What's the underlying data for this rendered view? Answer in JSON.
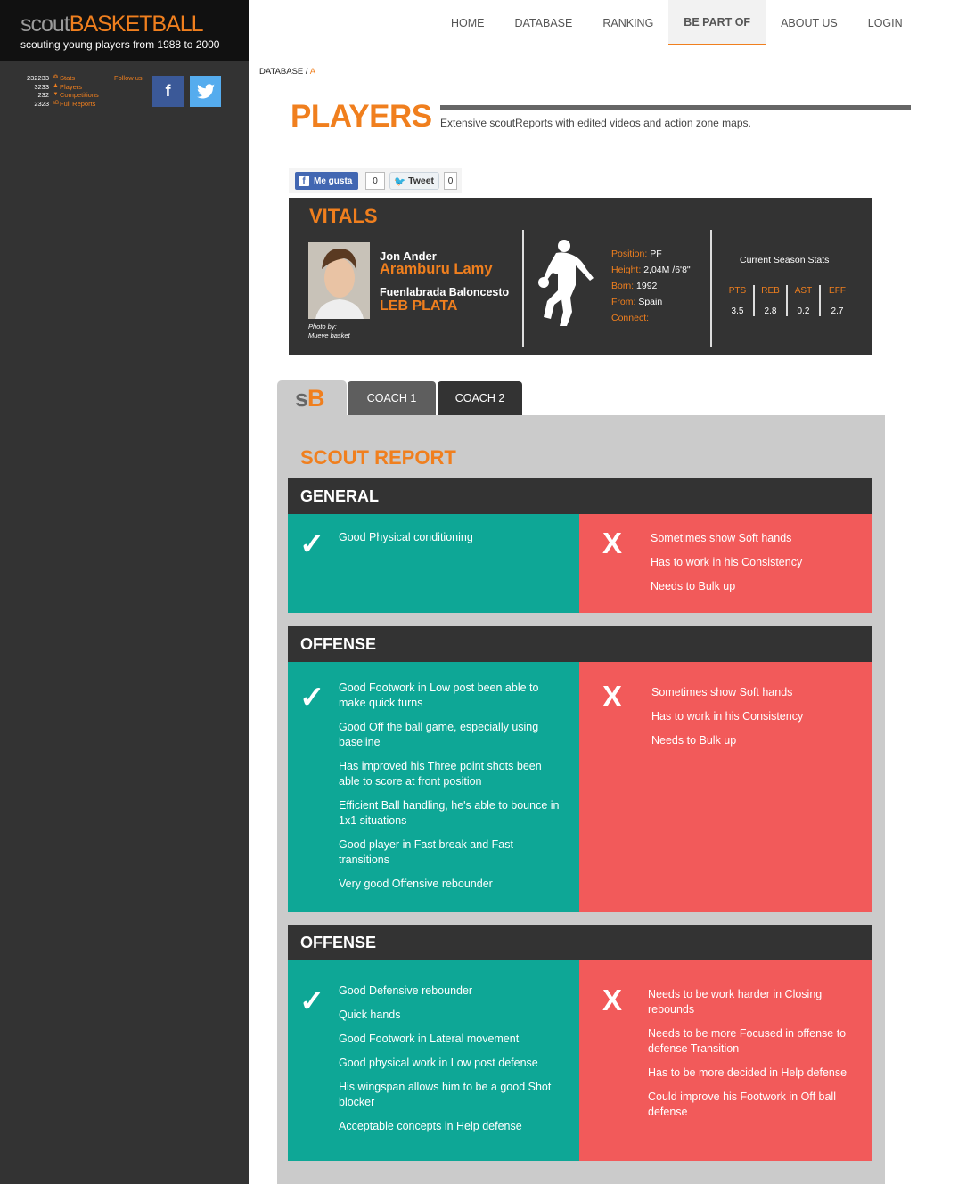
{
  "sidebar": {
    "logo_scout": "scout",
    "logo_basketball": "BASKETBALL",
    "tagline": "scouting young players from 1988 to 2000",
    "stats": [
      {
        "num": "232233",
        "icon": "❂",
        "label": "Stats"
      },
      {
        "num": "3233",
        "icon": "♟",
        "label": "Players"
      },
      {
        "num": "232",
        "icon": "▼",
        "label": "Competitions"
      },
      {
        "num": "2323",
        "icon": "sB",
        "label": "Full Reports"
      }
    ],
    "follow_label": "Follow us:",
    "facebook_glyph": "f",
    "twitter_glyph": "🐦"
  },
  "nav": {
    "home": "HOME",
    "database": "DATABASE",
    "ranking": "RANKING",
    "be_part_of": "BE PART OF",
    "about_us": "ABOUT US",
    "login": "LOGIN"
  },
  "breadcrumb": {
    "parent": "DATABASE",
    "sep": " / ",
    "current": "A"
  },
  "page": {
    "title": "PLAYERS",
    "subtitle": "Extensive scoutReports with edited videos and action zone maps."
  },
  "share": {
    "like_label": "Me gusta",
    "like_count": "0",
    "tweet_label": "Tweet",
    "tweet_count": "0"
  },
  "vitals": {
    "title": "VITALS",
    "photo_credit_1": "Photo by:",
    "photo_credit_2": "Mueve basket",
    "first_name": "Jon Ander",
    "last_name": "Aramburu Lamy",
    "team": "Fuenlabrada Baloncesto",
    "league": "LEB PLATA",
    "position_label": "Position:",
    "position": "PF",
    "height_label": "Height:",
    "height": "2,04M /6'8\"",
    "born_label": "Born:",
    "born": "1992",
    "from_label": "From:",
    "from": "Spain",
    "connect_label": "Connect:",
    "season_title": "Current Season Stats",
    "stats": [
      {
        "label": "PTS",
        "value": "3.5"
      },
      {
        "label": "REB",
        "value": "2.8"
      },
      {
        "label": "AST",
        "value": "0.2"
      },
      {
        "label": "EFF",
        "value": "2.7"
      }
    ]
  },
  "tabs": {
    "logo_s": "s",
    "logo_b": "B",
    "coach1": "COACH 1",
    "coach2": "COACH 2"
  },
  "report": {
    "title": "SCOUT REPORT",
    "sections": [
      {
        "heading": "GENERAL",
        "strengths": [
          "Good Physical conditioning"
        ],
        "weaknesses": [
          "Sometimes show Soft hands",
          "Has to work in his Consistency",
          "Needs to Bulk up"
        ]
      },
      {
        "heading": "OFFENSE",
        "strengths": [
          "Good Footwork in Low post been able to make quick turns",
          "Good Off the ball game, especially using baseline",
          "Has improved his Three point shots been able to score at front position",
          "Efficient Ball handling, he's able to bounce in 1x1 situations",
          "Good player in Fast break and Fast transitions",
          "Very good Offensive rebounder"
        ],
        "weaknesses": [
          "Sometimes show Soft hands",
          "Has to work in his Consistency",
          "Needs to Bulk up"
        ]
      },
      {
        "heading": "OFFENSE",
        "strengths": [
          "Good Defensive rebounder",
          "Quick hands",
          "Good Footwork in Lateral movement",
          "Good physical work in Low post defense",
          "His wingspan allows him to be a good Shot blocker",
          "Acceptable concepts in Help defense"
        ],
        "weaknesses": [
          "Needs to be work harder in Closing rebounds",
          "Needs to be more Focused in offense to defense Transition",
          "Has to be more decided in Help defense",
          "Could improve his Footwork in Off ball defense"
        ]
      }
    ],
    "check_glyph": "✓",
    "x_glyph": "X"
  },
  "colors": {
    "accent": "#f07f1e",
    "good": "#0ea796",
    "bad": "#f25a5a",
    "dark": "#333333"
  }
}
